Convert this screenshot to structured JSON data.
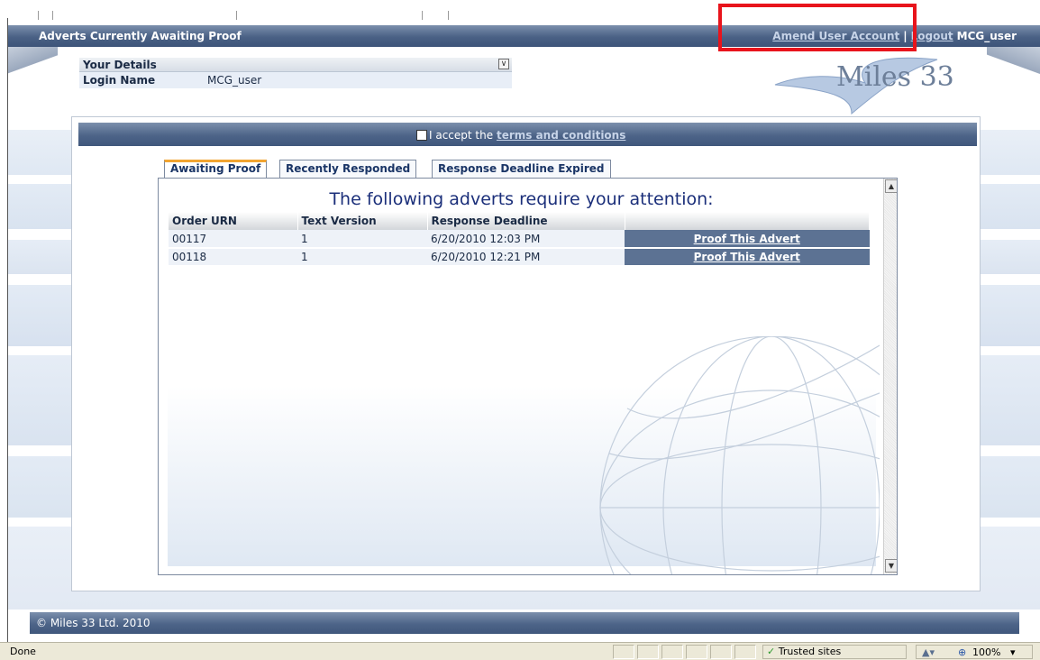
{
  "header": {
    "title": "Adverts Currently Awaiting Proof",
    "amend_link": "Amend User Account",
    "separator": "|",
    "logout_link": "Logout",
    "username": "MCG_user"
  },
  "details": {
    "heading": "Your Details",
    "login_label": "Login Name",
    "login_value": "MCG_user"
  },
  "logo": {
    "text": "Miles 33"
  },
  "terms": {
    "prefix": "I accept the",
    "link": "terms and conditions"
  },
  "tabs": [
    {
      "label": "Awaiting Proof",
      "active": true
    },
    {
      "label": "Recently Responded",
      "active": false
    },
    {
      "label": "Response Deadline Expired",
      "active": false
    }
  ],
  "main": {
    "title": "The following adverts require your attention:",
    "columns": [
      "Order URN",
      "Text Version",
      "Response Deadline",
      ""
    ],
    "rows": [
      {
        "urn": "00117",
        "version": "1",
        "deadline": "6/20/2010 12:03 PM",
        "action": "Proof This Advert"
      },
      {
        "urn": "00118",
        "version": "1",
        "deadline": "6/20/2010 12:21 PM",
        "action": "Proof This Advert"
      }
    ]
  },
  "footer": {
    "copyright": "© Miles 33 Ltd. 2010"
  },
  "statusbar": {
    "status": "Done",
    "zone": "Trusted sites",
    "zoom": "100%"
  },
  "colors": {
    "accent_bar": "#4a6185",
    "action_button": "#5c7293",
    "highlight": "#e8141c",
    "active_tab": "#f2a531"
  }
}
